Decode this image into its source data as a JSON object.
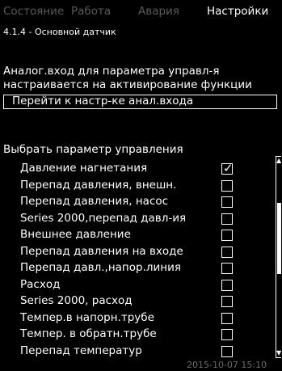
{
  "tabs": {
    "status": "Состояние",
    "operation": "Работа",
    "alarm": "Авария",
    "settings": "Настройки"
  },
  "menu_code": "4.1.4 - Основной датчик",
  "description": "Аналог.вход для параметра управл-я настраивается на активирование функции",
  "goto_button": "Перейти к настр-ке анал.входа",
  "list": {
    "title": "Выбрать параметр управления",
    "items": [
      {
        "label": "Давление нагнетания",
        "checked": true
      },
      {
        "label": "Перепад давления, внешн.",
        "checked": false
      },
      {
        "label": "Перепад давления, насос",
        "checked": false
      },
      {
        "label": "Series 2000,перепад давл-ия",
        "checked": false
      },
      {
        "label": "Внешнее давление",
        "checked": false
      },
      {
        "label": "Перепад давления на входе",
        "checked": false
      },
      {
        "label": "Перепад давл.,напор.линия",
        "checked": false
      },
      {
        "label": "Расход",
        "checked": false
      },
      {
        "label": "Series 2000, расход",
        "checked": false
      },
      {
        "label": "Темпер.в напорн.трубе",
        "checked": false
      },
      {
        "label": "Темпер. в обратн.трубе",
        "checked": false
      },
      {
        "label": "Перепад температур",
        "checked": false
      }
    ]
  },
  "timestamp": "2015-10-07 15:10",
  "colors": {
    "background": "#000000",
    "text": "#ffffff",
    "inactive_tab": "#5a5a5a"
  },
  "icons": {
    "checkbox_tick": "check-icon",
    "scroll_up": "triangle-up-icon",
    "scroll_down": "triangle-down-icon"
  }
}
